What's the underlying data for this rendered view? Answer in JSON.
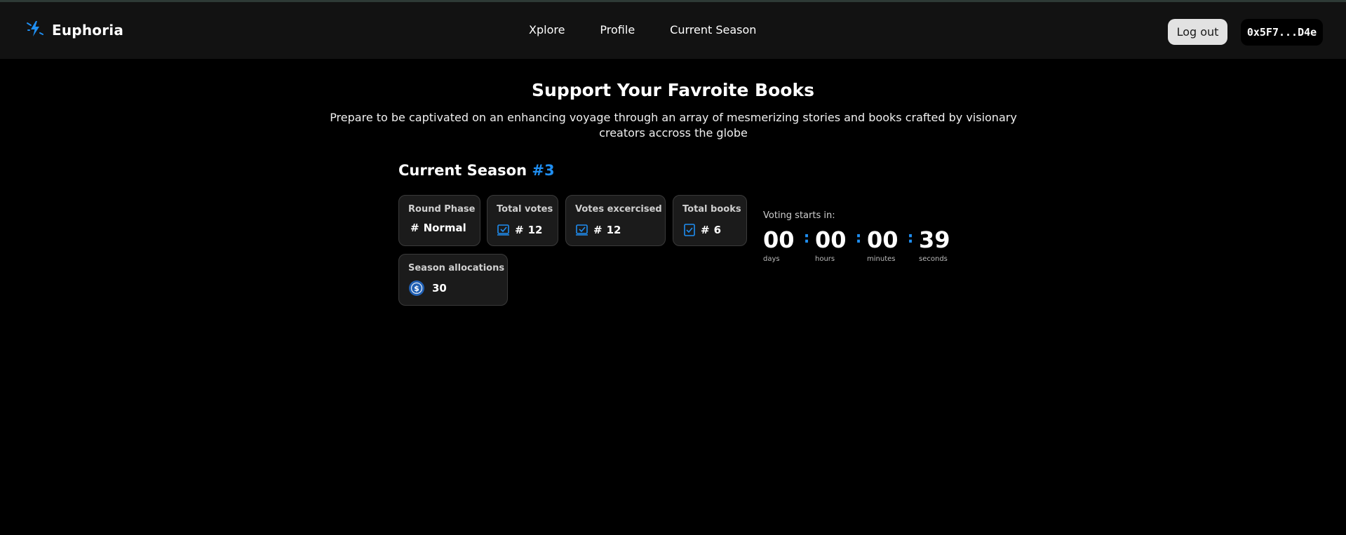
{
  "app": {
    "name": "Euphoria"
  },
  "nav": [
    "Xplore",
    "Profile",
    "Current Season"
  ],
  "header": {
    "logout_label": "Log out",
    "wallet_label": "0x5F7...D4e"
  },
  "hero": {
    "title": "Support Your Favroite Books",
    "subtitle": "Prepare to be captivated on an enhancing voyage through an array of mesmerizing stories and books crafted by visionary creators accross the globe"
  },
  "season": {
    "title": "Current Season",
    "number": "#3",
    "cards": {
      "round_phase": {
        "label": "Round Phase",
        "prefix": "#",
        "value": "Normal"
      },
      "total_votes": {
        "label": "Total votes",
        "prefix": "#",
        "value": "12"
      },
      "votes_exercised": {
        "label": "Votes excercised",
        "prefix": "#",
        "value": "12"
      },
      "total_books": {
        "label": "Total books",
        "prefix": "#",
        "value": "6"
      },
      "season_allocations": {
        "label": "Season allocations",
        "value": "30"
      }
    }
  },
  "countdown": {
    "label": "Voting starts in:",
    "units": [
      {
        "value": "00",
        "caption": "days"
      },
      {
        "value": "00",
        "caption": "hours"
      },
      {
        "value": "00",
        "caption": "minutes"
      },
      {
        "value": "39",
        "caption": "seconds"
      }
    ],
    "separator": ":"
  },
  "colors": {
    "accent": "#1f8ef1",
    "header_bg": "#121212",
    "card_bg": "#1b1b1b",
    "page_bg": "#000000"
  },
  "icons": [
    "lightning-logo-icon",
    "vote-check-icon",
    "book-check-icon",
    "coin-dollar-icon"
  ]
}
